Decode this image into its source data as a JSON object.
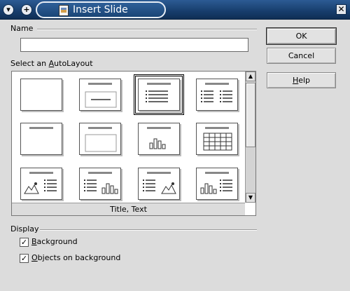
{
  "window": {
    "title": "Insert Slide",
    "menu_glyph": "▾",
    "shade_glyph": "+",
    "close_glyph": "✕"
  },
  "name_section": {
    "label": "Name",
    "input_value": ""
  },
  "autolayout_section": {
    "label_pre": "Select an ",
    "label_mnemonic": "A",
    "label_post": "utoLayout",
    "selected_caption": "Title, Text",
    "selected_index": 2,
    "layouts": [
      "blank",
      "title-content",
      "title-text",
      "title-two-columns",
      "title-only",
      "title-box",
      "title-chart",
      "title-table",
      "title-clipart-text",
      "title-text-chart",
      "title-text-clipart",
      "title-chart-text"
    ]
  },
  "buttons": {
    "ok": "OK",
    "cancel": "Cancel",
    "help_mnemonic": "H",
    "help_rest": "elp"
  },
  "display_section": {
    "label": "Display",
    "background": {
      "mnemonic": "B",
      "rest": "ackground",
      "checked": true
    },
    "objects": {
      "mnemonic": "O",
      "rest": "bjects on background",
      "checked": true
    }
  },
  "icons": {
    "scroll_up": "▲",
    "scroll_down": "▼",
    "check": "✓"
  }
}
